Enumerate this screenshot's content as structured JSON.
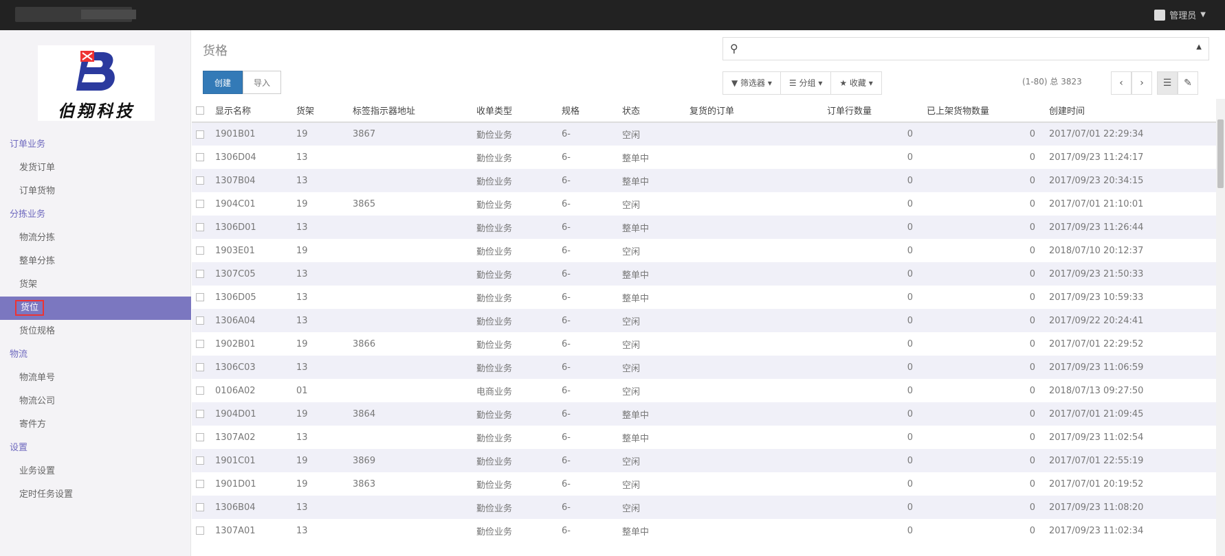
{
  "topbar": {
    "user": "管理员"
  },
  "logo": {
    "text": "伯翔科技",
    "mark": "B"
  },
  "sidebar": {
    "sections": [
      {
        "title": "订单业务",
        "items": [
          "发货订单",
          "订单货物"
        ]
      },
      {
        "title": "分拣业务",
        "items": [
          "物流分拣",
          "整单分拣",
          "货架",
          "货位",
          "货位规格"
        ]
      },
      {
        "title": "物流",
        "items": [
          "物流单号",
          "物流公司",
          "寄件方"
        ]
      },
      {
        "title": "设置",
        "items": [
          "业务设置",
          "定时任务设置"
        ]
      }
    ],
    "active": "货位"
  },
  "main": {
    "title": "货格",
    "create_label": "创建",
    "import_label": "导入",
    "filter_label": "筛选器",
    "group_label": "分组",
    "favorites_label": "收藏",
    "pager_text": "(1-80) 总 3823"
  },
  "table": {
    "columns": [
      "显示名称",
      "货架",
      "标签指示器地址",
      "收单类型",
      "规格",
      "状态",
      "复货的订单",
      "订单行数量",
      "已上架货物数量",
      "创建时间"
    ],
    "rows": [
      [
        "1901B01",
        "19",
        "3867",
        "勤俭业务",
        "6-",
        "空闲",
        "",
        "0",
        "0",
        "2017/07/01 22:29:34"
      ],
      [
        "1306D04",
        "13",
        "",
        "勤俭业务",
        "6-",
        "整单中",
        "",
        "0",
        "0",
        "2017/09/23 11:24:17"
      ],
      [
        "1307B04",
        "13",
        "",
        "勤俭业务",
        "6-",
        "整单中",
        "",
        "0",
        "0",
        "2017/09/23 20:34:15"
      ],
      [
        "1904C01",
        "19",
        "3865",
        "勤俭业务",
        "6-",
        "空闲",
        "",
        "0",
        "0",
        "2017/07/01 21:10:01"
      ],
      [
        "1306D01",
        "13",
        "",
        "勤俭业务",
        "6-",
        "整单中",
        "",
        "0",
        "0",
        "2017/09/23 11:26:44"
      ],
      [
        "1903E01",
        "19",
        "",
        "勤俭业务",
        "6-",
        "空闲",
        "",
        "0",
        "0",
        "2018/07/10 20:12:37"
      ],
      [
        "1307C05",
        "13",
        "",
        "勤俭业务",
        "6-",
        "整单中",
        "",
        "0",
        "0",
        "2017/09/23 21:50:33"
      ],
      [
        "1306D05",
        "13",
        "",
        "勤俭业务",
        "6-",
        "整单中",
        "",
        "0",
        "0",
        "2017/09/23 10:59:33"
      ],
      [
        "1306A04",
        "13",
        "",
        "勤俭业务",
        "6-",
        "空闲",
        "",
        "0",
        "0",
        "2017/09/22 20:24:41"
      ],
      [
        "1902B01",
        "19",
        "3866",
        "勤俭业务",
        "6-",
        "空闲",
        "",
        "0",
        "0",
        "2017/07/01 22:29:52"
      ],
      [
        "1306C03",
        "13",
        "",
        "勤俭业务",
        "6-",
        "空闲",
        "",
        "0",
        "0",
        "2017/09/23 11:06:59"
      ],
      [
        "0106A02",
        "01",
        "",
        "电商业务",
        "6-",
        "空闲",
        "",
        "0",
        "0",
        "2018/07/13 09:27:50"
      ],
      [
        "1904D01",
        "19",
        "3864",
        "勤俭业务",
        "6-",
        "整单中",
        "",
        "0",
        "0",
        "2017/07/01 21:09:45"
      ],
      [
        "1307A02",
        "13",
        "",
        "勤俭业务",
        "6-",
        "整单中",
        "",
        "0",
        "0",
        "2017/09/23 11:02:54"
      ],
      [
        "1901C01",
        "19",
        "3869",
        "勤俭业务",
        "6-",
        "空闲",
        "",
        "0",
        "0",
        "2017/07/01 22:55:19"
      ],
      [
        "1901D01",
        "19",
        "3863",
        "勤俭业务",
        "6-",
        "空闲",
        "",
        "0",
        "0",
        "2017/07/01 20:19:52"
      ],
      [
        "1306B04",
        "13",
        "",
        "勤俭业务",
        "6-",
        "空闲",
        "",
        "0",
        "0",
        "2017/09/23 11:08:20"
      ],
      [
        "1307A01",
        "13",
        "",
        "勤俭业务",
        "6-",
        "整单中",
        "",
        "0",
        "0",
        "2017/09/23 11:02:34"
      ]
    ]
  }
}
